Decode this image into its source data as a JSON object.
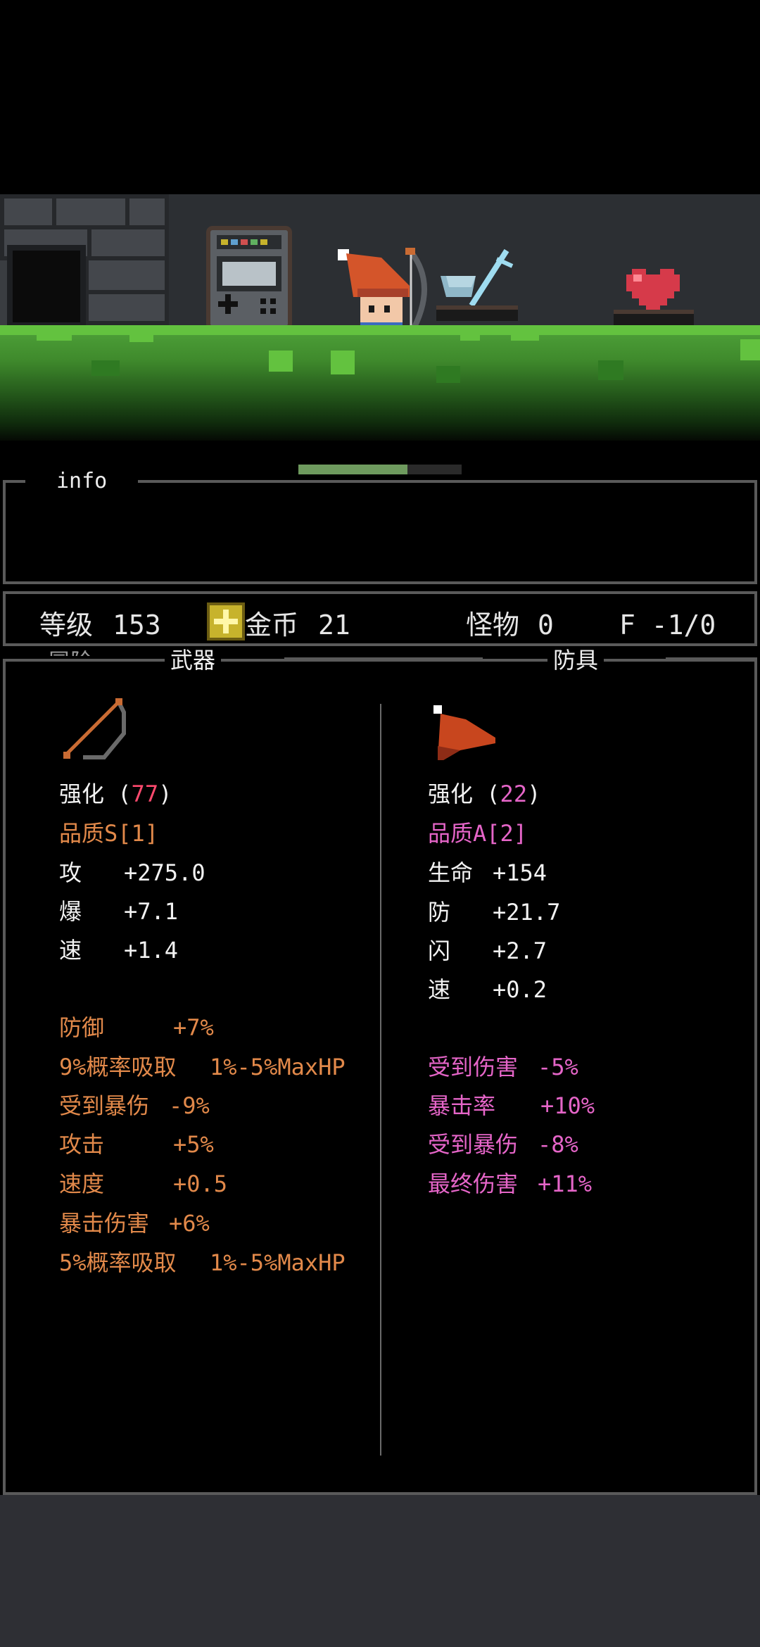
{
  "colors": {
    "scene_wall": "#2c2f33",
    "grass": "#4fa33a",
    "panel_border": "#5a5a5a",
    "quality_s": "#e2894a",
    "quality_a": "#e565c8",
    "enhance_number": "#ff4a6e",
    "bottom_area": "#2e2f34"
  },
  "scene": {
    "items": [
      "gameboy-icon",
      "hero-archer",
      "crystal-sword-icon",
      "heart-icon"
    ],
    "progress": 0.67
  },
  "info_panel": {
    "title": "info"
  },
  "stats": {
    "level_label": "等级",
    "level_value": "153",
    "gold_label": "金币",
    "gold_value": "21",
    "monster_label": "怪物",
    "monster_value": "0",
    "floor_text": "F -1/0"
  },
  "tabs": {
    "hidden_left": "冒险",
    "weapon": "武器",
    "armor": "防具"
  },
  "weapon": {
    "icon": "bow-icon",
    "enhance_label": "强化",
    "enhance_value": "77",
    "quality": "品质S[1]",
    "base_stats": [
      {
        "label": "攻",
        "value": "+275.0"
      },
      {
        "label": "爆",
        "value": "+7.1"
      },
      {
        "label": "速",
        "value": "+1.4"
      }
    ],
    "bonuses": [
      {
        "label": "防御",
        "value": "+7%"
      },
      {
        "label": "9%概率吸取",
        "value": "1%-5%MaxHP"
      },
      {
        "label": "受到暴伤",
        "value": "-9%"
      },
      {
        "label": "攻击",
        "value": "+5%"
      },
      {
        "label": "速度",
        "value": "+0.5"
      },
      {
        "label": "暴击伤害",
        "value": "+6%"
      },
      {
        "label": "5%概率吸取",
        "value": "1%-5%MaxHP"
      }
    ]
  },
  "armor": {
    "icon": "wizard-hat-icon",
    "enhance_label": "强化",
    "enhance_value": "22",
    "quality": "品质A[2]",
    "base_stats": [
      {
        "label": "生命",
        "value": "+154"
      },
      {
        "label": "防",
        "value": "+21.7"
      },
      {
        "label": "闪",
        "value": "+2.7"
      },
      {
        "label": "速",
        "value": "+0.2"
      }
    ],
    "bonuses": [
      {
        "label": "受到伤害",
        "value": "-5%"
      },
      {
        "label": "暴击率",
        "value": "+10%"
      },
      {
        "label": "受到暴伤",
        "value": "-8%"
      },
      {
        "label": "最终伤害",
        "value": "+11%"
      }
    ]
  }
}
